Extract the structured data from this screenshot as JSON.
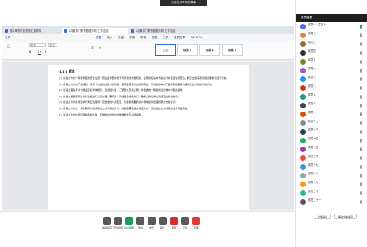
{
  "banner": {
    "text": "你正在共享你的屏幕"
  },
  "browser": {
    "tabs": [
      {
        "label": "提示审查项目进度汇报材料"
      },
      {
        "label": "1月某部门考核数据分析-工作总结"
      },
      {
        "label": "1月某部门考核数据分析-工作总结"
      }
    ]
  },
  "writer": {
    "menus": [
      "文件",
      "开始",
      "插入",
      "页面",
      "引用",
      "审阅",
      "视图",
      "工具",
      "会员专享",
      "WPS AI"
    ],
    "active_menu": "开始",
    "font_name": "宋体",
    "font_size": "五号",
    "styles": [
      "正文",
      "标题 1",
      "标题 2",
      "标题 3"
    ],
    "doc": {
      "heading": "4.1.1  要求",
      "paragraphs": [
        "(1) 投递方大约一有零件结构安全设置一套设备卡里的标号与平测式中部机械，在预测机总体方案设计中包括在调研后，制定出保证项目规划要求与运行方案。",
        "(2) 投递方大约在产品投置一条整个为组的数据分析框架，使用套装进行合理测算后，形成能反映本产品年实际要求的投资建议与整体参数标准。",
        "(3) 投递方首先有计划地设置好整体框架，包含接入层、汇聚层以及核心层，并遵循统一网络协议标准执行相关操作。",
        "(4) 投递方根据实际业务对数据进行分层处理，需按各个阶段任务编排执行，确保方案能够达到规范的系统指标。",
        "(5) 投递方大约在项目执行时应当保持一定数量的人员配置，为其他需要的用户群体提供合理的服务方案设计。",
        "(6) 投递方大约在一定的期限内完成系统上线与调试工作，并根据需要提交相应文档，保证后续交付的完整性与可追溯性。",
        "(7) 投递方大约在项目验收阶段之前，整理并提交最终的数据报告与总结说明。"
      ]
    }
  },
  "controls": [
    {
      "label": "解除静音",
      "icon": "microphone-icon",
      "color": "#5a5a5a"
    },
    {
      "label": "开启视频",
      "icon": "camera-icon",
      "color": "#5a5a5a"
    },
    {
      "label": "共享屏幕",
      "icon": "share-screen-icon",
      "color": "#18a058"
    },
    {
      "label": "邀请",
      "icon": "invite-icon",
      "color": "#5a5a5a"
    },
    {
      "label": "成员",
      "icon": "members-icon",
      "color": "#5a5a5a"
    },
    {
      "label": "聊天",
      "icon": "chat-icon",
      "color": "#5a5a5a"
    },
    {
      "label": "录制",
      "icon": "record-icon",
      "color": "#d03030"
    },
    {
      "label": "应用",
      "icon": "apps-icon",
      "color": "#5a5a5a"
    },
    {
      "label": "结束",
      "icon": "leave-icon",
      "color": "#e03a3a"
    }
  ],
  "panel": {
    "title": "成员管理",
    "members": [
      {
        "name": "成员一（主持人）",
        "sub": "",
        "color": "#4a6cf7",
        "mic": true
      },
      {
        "name": "成员二",
        "sub": "",
        "color": "#e8833a",
        "mic": false
      },
      {
        "name": "成员三",
        "sub": "",
        "color": "#8a6d3b",
        "mic": false
      },
      {
        "name": "成员四",
        "sub": "",
        "color": "#2f2f2f",
        "mic": false
      },
      {
        "name": "成员五",
        "sub": "",
        "color": "#6b8e23",
        "mic": false
      },
      {
        "name": "成员六",
        "sub": "",
        "color": "#9b59b6",
        "mic": false
      },
      {
        "name": "成员七",
        "sub": "",
        "color": "#1e90ff",
        "mic": false
      },
      {
        "name": "成员八",
        "sub": "",
        "color": "#c0392b",
        "mic": false
      },
      {
        "name": "成员九",
        "sub": "",
        "color": "#16a085",
        "mic": false
      },
      {
        "name": "成员十",
        "sub": "",
        "color": "#34495e",
        "mic": false
      },
      {
        "name": "成员十一",
        "sub": "",
        "color": "#d35400",
        "mic": false
      },
      {
        "name": "成员十二",
        "sub": "",
        "color": "#7f8c8d",
        "mic": false
      },
      {
        "name": "成员十三",
        "sub": "",
        "color": "#2c3e50",
        "mic": false
      },
      {
        "name": "成员十四",
        "sub": "",
        "color": "#27ae60",
        "mic": false
      },
      {
        "name": "成员十五",
        "sub": "",
        "color": "#8e44ad",
        "mic": false
      },
      {
        "name": "成员十六",
        "sub": "",
        "color": "#e74c3c",
        "mic": false
      },
      {
        "name": "成员十七",
        "sub": "",
        "color": "#3498db",
        "mic": false
      },
      {
        "name": "成员十八",
        "sub": "",
        "color": "#95a5a6",
        "mic": false
      },
      {
        "name": "成员十九",
        "sub": "",
        "color": "#f39c12",
        "mic": false
      },
      {
        "name": "成员二十",
        "sub": "",
        "color": "#1abc9c",
        "mic": false
      },
      {
        "name": "成员二十一",
        "sub": "",
        "color": "#555555",
        "mic": false
      }
    ],
    "buttons": [
      "全体静音",
      "解除全体静音"
    ]
  }
}
